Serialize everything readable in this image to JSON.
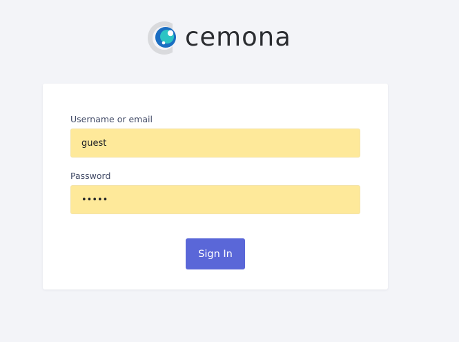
{
  "brand": {
    "name": "cemona",
    "logo_icon": "cemona-logo-icon"
  },
  "login_form": {
    "username": {
      "label": "Username or email",
      "value": "guest"
    },
    "password": {
      "label": "Password",
      "value": "guest"
    },
    "submit_label": "Sign In"
  },
  "colors": {
    "page_background": "#f3f4f8",
    "card_background": "#ffffff",
    "autofill_input_background": "#fee99a",
    "button_background": "#5a67d8",
    "button_text": "#ffffff",
    "logo_ring": "#d9dadd",
    "logo_blue": "#1b6ec2",
    "logo_teal": "#2cc4c4"
  }
}
